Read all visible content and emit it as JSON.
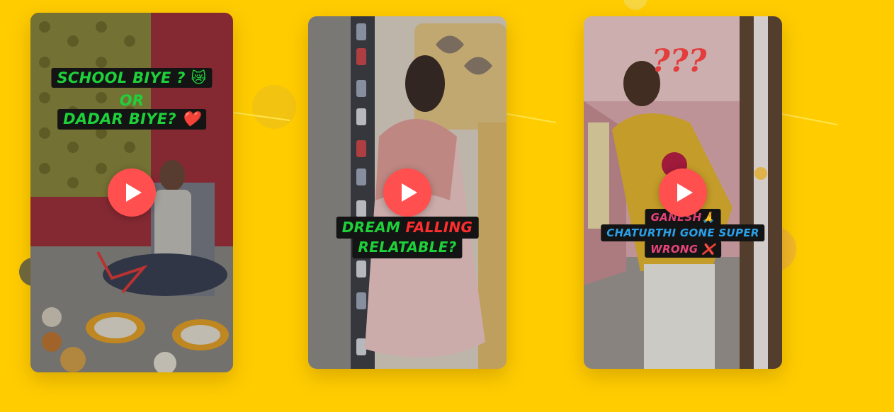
{
  "videos": [
    {
      "captions": {
        "line1": "SCHOOL BIYE ? 😿",
        "line2": "OR",
        "line3": "DADAR BIYE? ❤️"
      },
      "play_icon": "play-icon"
    },
    {
      "captions": {
        "line1_a": "DREAM ",
        "line1_b": "FALLING",
        "line2": "RELATABLE?"
      },
      "play_icon": "play-icon"
    },
    {
      "captions": {
        "line1": "GANESH🙏",
        "line2": "CHATURTHI GONE SUPER",
        "line3": "WRONG ❌",
        "question_marks": "???"
      },
      "play_icon": "play-icon"
    }
  ],
  "colors": {
    "background": "#ffcc00",
    "play_button": "#ff4f4f",
    "caption_green": "#1ed13a",
    "caption_red": "#ff2d2d",
    "caption_blue": "#2aa0e8",
    "caption_pink": "#e8457a"
  }
}
